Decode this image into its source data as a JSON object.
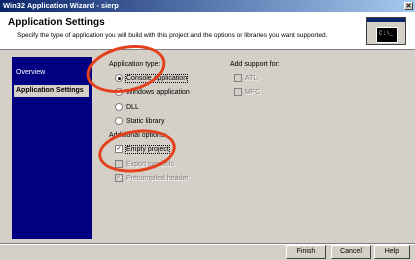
{
  "window": {
    "title": "Win32 Application Wizard - sierp",
    "close_glyph": "✕"
  },
  "header": {
    "title": "Application Settings",
    "subtitle": "Specify the type of application you will build with this project and the options or libraries you want supported.",
    "console_prompt": "C:\\_"
  },
  "nav": {
    "items": [
      "Overview",
      "Application Settings"
    ]
  },
  "app_type": {
    "label": "Application type:",
    "options": [
      "Console application",
      "Windows application",
      "DLL",
      "Static library"
    ]
  },
  "add_support": {
    "label": "Add support for:",
    "options": [
      "ATL",
      "MFC"
    ]
  },
  "additional": {
    "label": "Additional options:",
    "options": [
      "Empty project",
      "Export symbols",
      "Precompiled header"
    ]
  },
  "buttons": {
    "finish": "Finish",
    "cancel": "Cancel",
    "help": "Help"
  },
  "colors": {
    "highlight_circle": "#e4401c",
    "title_bar": "#0a246a",
    "nav_bg": "#000080"
  }
}
